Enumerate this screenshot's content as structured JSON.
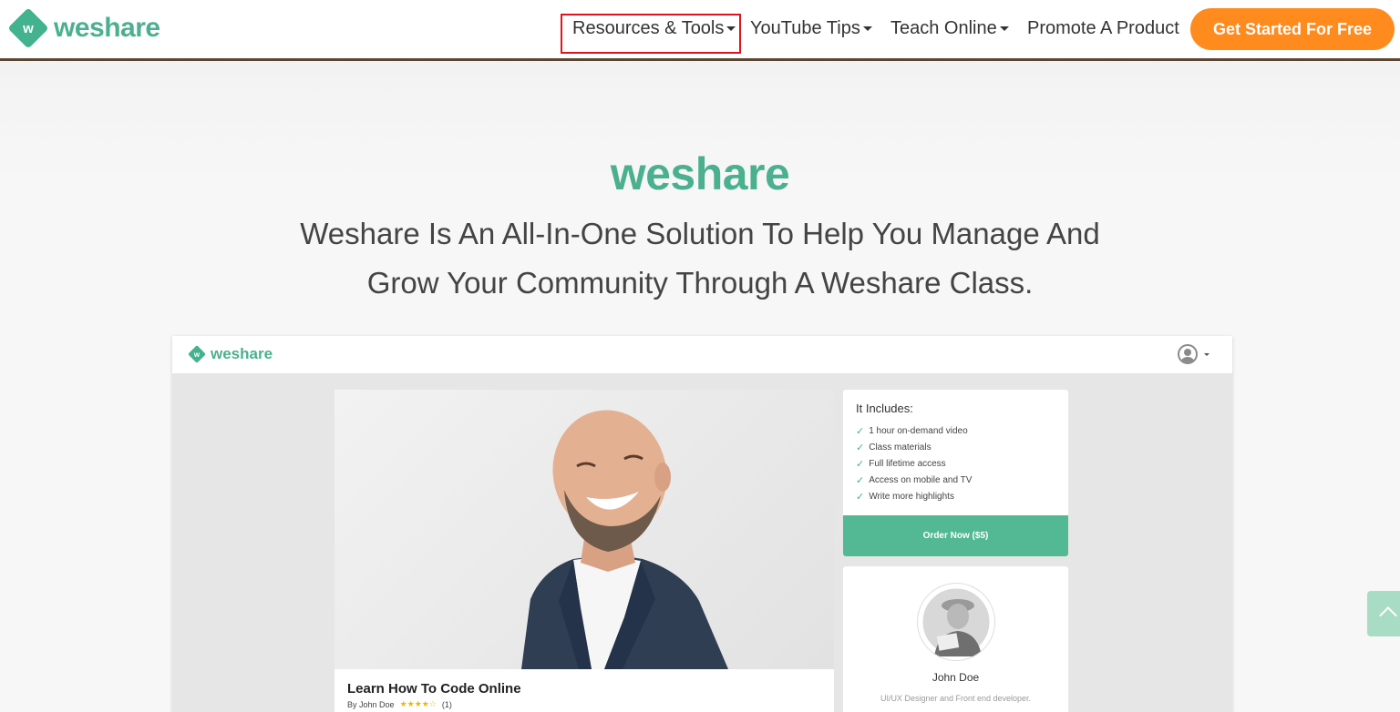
{
  "header": {
    "logo_mark": "w",
    "logo_text": "weshare",
    "nav": [
      {
        "label": "Resources & Tools",
        "has_dropdown": true
      },
      {
        "label": "YouTube Tips",
        "has_dropdown": true
      },
      {
        "label": "Teach Online",
        "has_dropdown": true
      },
      {
        "label": "Promote A Product",
        "has_dropdown": false
      }
    ],
    "cta_label": "Get Started For Free"
  },
  "hero": {
    "logo_text": "weshare",
    "tagline_line1": "Weshare Is An All-In-One Solution To Help You Manage And",
    "tagline_line2": "Grow Your Community Through A Weshare Class."
  },
  "mockup": {
    "logo_mark": "w",
    "logo_text": "weshare",
    "course": {
      "title": "Learn How To Code Online",
      "by_label": "By",
      "author": "John Doe",
      "rating": 4,
      "rating_max": 5,
      "review_count": "(1)"
    },
    "includes": {
      "title": "It Includes:",
      "items": [
        "1 hour on-demand video",
        "Class materials",
        "Full lifetime access",
        "Access on mobile and TV",
        "Write more highlights"
      ],
      "order_label": "Order Now ($5)"
    },
    "author_card": {
      "name": "John Doe",
      "bio": "UI/UX Designer and Front end developer."
    }
  },
  "colors": {
    "brand_green": "#4bb08f",
    "cta_orange": "#ff8a1e",
    "highlight_red": "#e0141e",
    "order_green": "#52b994"
  }
}
